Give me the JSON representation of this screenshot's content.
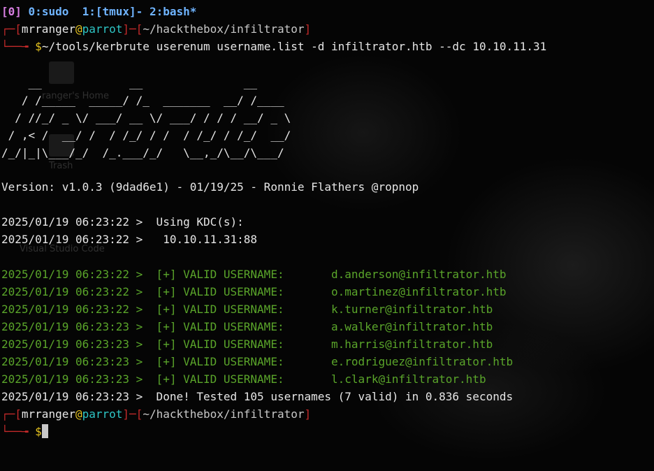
{
  "tmux_bar": {
    "session": "[0]",
    "windows": "0:sudo  1:[tmux]- 2:bash*"
  },
  "prompt": {
    "user": "mrranger",
    "at": "@",
    "host": "parrot",
    "path": "~/hackthebox/infiltrator",
    "symbol": "$"
  },
  "command": "~/tools/kerbrute userenum username.list -d infiltrator.htb --dc 10.10.11.31",
  "banner": [
    "    __             __               __     ",
    "   / /_____  _____/ /_  _______  __/ /____ ",
    "  / //_/ _ \\/ ___/ __ \\/ ___/ / / / __/ _ \\",
    " / ,< /  __/ /  / /_/ / /  / /_/ / /_/  __/",
    "/_/|_|\\___/_/  /_.___/_/   \\__,_/\\__/\\___/ "
  ],
  "version": "Version: v1.0.3 (9dad6e1) - 01/19/25 - Ronnie Flathers @ropnop",
  "kdc_lines": [
    "2025/01/19 06:23:22 >  Using KDC(s):",
    "2025/01/19 06:23:22 >   10.10.11.31:88"
  ],
  "valid_users": [
    {
      "prefix": "2025/01/19 06:23:22 >  [+] VALID USERNAME:       ",
      "user": "d.anderson@infiltrator.htb"
    },
    {
      "prefix": "2025/01/19 06:23:22 >  [+] VALID USERNAME:       ",
      "user": "o.martinez@infiltrator.htb"
    },
    {
      "prefix": "2025/01/19 06:23:22 >  [+] VALID USERNAME:       ",
      "user": "k.turner@infiltrator.htb"
    },
    {
      "prefix": "2025/01/19 06:23:23 >  [+] VALID USERNAME:       ",
      "user": "a.walker@infiltrator.htb"
    },
    {
      "prefix": "2025/01/19 06:23:23 >  [+] VALID USERNAME:       ",
      "user": "m.harris@infiltrator.htb"
    },
    {
      "prefix": "2025/01/19 06:23:23 >  [+] VALID USERNAME:       ",
      "user": "e.rodriguez@infiltrator.htb"
    },
    {
      "prefix": "2025/01/19 06:23:23 >  [+] VALID USERNAME:       ",
      "user": "l.clark@infiltrator.htb"
    }
  ],
  "done_line": "2025/01/19 06:23:23 >  Done! Tested 105 usernames (7 valid) in 0.836 seconds",
  "desktop_ghosts": {
    "home_label": "ranger's Home",
    "trash_label": "Trash",
    "vscode_label": "Visual Studio Code"
  },
  "colors": {
    "prompt_bracket": "#c42a2a",
    "host": "#2ec6c6",
    "prompt_symbol": "#e5c31f",
    "valid": "#5aa52a",
    "tmux_bar": "#6fb4ff"
  }
}
